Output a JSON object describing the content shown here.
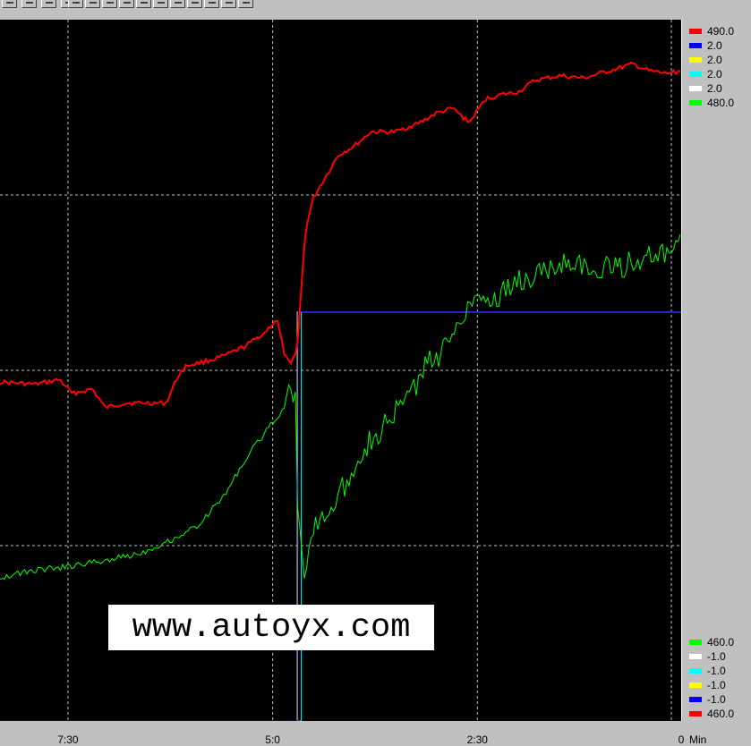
{
  "toolbar": {
    "buttons": [
      "btn-1",
      "btn-2",
      "btn-3",
      "btn-4",
      "btn-5",
      "btn-6",
      "btn-7",
      "btn-8",
      "btn-9",
      "btn-10",
      "btn-11",
      "btn-12",
      "btn-13",
      "btn-14",
      "btn-15"
    ]
  },
  "watermark": {
    "text": "www.autoyx.com"
  },
  "legend_top": [
    {
      "color": "#ff0000",
      "label": "490.0"
    },
    {
      "color": "#0000ff",
      "label": "2.0"
    },
    {
      "color": "#ffff00",
      "label": "2.0"
    },
    {
      "color": "#00ffff",
      "label": "2.0"
    },
    {
      "color": "#ffffff",
      "label": "2.0"
    },
    {
      "color": "#00ff00",
      "label": "480.0"
    }
  ],
  "legend_bottom": [
    {
      "color": "#00ff00",
      "label": "460.0"
    },
    {
      "color": "#ffffff",
      "label": "-1.0"
    },
    {
      "color": "#00ffff",
      "label": "-1.0"
    },
    {
      "color": "#ffff00",
      "label": "-1.0"
    },
    {
      "color": "#0000ff",
      "label": "-1.0"
    },
    {
      "color": "#ff0000",
      "label": "460.0"
    }
  ],
  "x_unit": "Min",
  "chart_data": {
    "type": "line",
    "x_ticks": [
      {
        "value": 7.5,
        "label": "7:30"
      },
      {
        "value": 5.0,
        "label": "5:0"
      },
      {
        "value": 2.5,
        "label": "2:30"
      },
      {
        "value": 0,
        "label": "0"
      }
    ],
    "xlim": [
      8.33,
      0
    ],
    "grid": true,
    "series": [
      {
        "color": "#ff0000",
        "ylim": [
          460,
          490
        ],
        "x": [
          8.33,
          7.9,
          7.6,
          7.45,
          7.2,
          7.05,
          6.8,
          6.6,
          6.3,
          6.15,
          6.05,
          5.8,
          5.6,
          5.35,
          5.1,
          4.95,
          4.85,
          4.78,
          4.7,
          4.6,
          4.5,
          4.4,
          4.2,
          4.0,
          3.8,
          3.5,
          3.2,
          3.0,
          2.8,
          2.6,
          2.4,
          2.2,
          2.0,
          1.8,
          1.5,
          1.2,
          1.0,
          0.8,
          0.6,
          0.4,
          0.2,
          0.0
        ],
        "values": [
          474.5,
          474.4,
          474.6,
          474.0,
          474.2,
          473.4,
          473.6,
          473.6,
          473.6,
          474.8,
          475.2,
          475.4,
          475.6,
          476.0,
          476.6,
          477.2,
          475.6,
          475.2,
          476.0,
          481.0,
          482.4,
          483.0,
          484.2,
          484.6,
          485.2,
          485.2,
          485.6,
          486.0,
          486.2,
          485.6,
          486.6,
          486.8,
          486.9,
          487.4,
          487.6,
          487.5,
          487.7,
          487.9,
          488.1,
          487.8,
          487.7,
          487.8
        ]
      },
      {
        "color": "#00ff00",
        "ylim": [
          460,
          480
        ],
        "x": [
          8.33,
          7.9,
          7.5,
          7.0,
          6.6,
          6.2,
          5.9,
          5.6,
          5.4,
          5.2,
          5.0,
          4.85,
          4.78,
          4.72,
          4.7,
          4.65,
          4.6,
          4.5,
          4.3,
          4.1,
          3.9,
          3.7,
          3.5,
          3.3,
          3.1,
          2.9,
          2.7,
          2.5,
          2.3,
          2.1,
          1.9,
          1.7,
          1.5,
          1.3,
          1.1,
          0.9,
          0.7,
          0.5,
          0.3,
          0.1,
          0.0
        ],
        "values": [
          464.1,
          464.3,
          464.4,
          464.6,
          464.8,
          465.2,
          465.6,
          466.4,
          467.2,
          467.9,
          468.5,
          469.0,
          469.8,
          469.0,
          466.4,
          465.0,
          464.0,
          465.6,
          466.0,
          466.8,
          467.8,
          468.2,
          468.8,
          469.4,
          470.2,
          470.6,
          471.6,
          472.2,
          472.0,
          472.4,
          472.6,
          472.8,
          473.0,
          473.2,
          472.6,
          473.0,
          473.0,
          473.2,
          473.2,
          473.4,
          473.6
        ]
      },
      {
        "color": "#00ffff",
        "ylim": [
          -1,
          2
        ],
        "x": [
          8.33,
          4.75,
          4.75,
          4.65,
          4.65,
          0.0
        ],
        "values": [
          -1.0,
          -1.0,
          -1.0,
          -1.0,
          0.75,
          0.75
        ]
      },
      {
        "color": "#ffff00",
        "ylim": [
          -1,
          2
        ],
        "x": [
          8.33,
          4.7,
          4.7,
          0.0
        ],
        "values": [
          -1.0,
          -1.0,
          0.75,
          0.75
        ]
      },
      {
        "color": "#0000ff",
        "ylim": [
          -1,
          2
        ],
        "x": [
          8.33,
          4.69,
          4.69,
          0.0
        ],
        "values": [
          -1.0,
          -1.0,
          0.75,
          0.75
        ]
      }
    ]
  }
}
